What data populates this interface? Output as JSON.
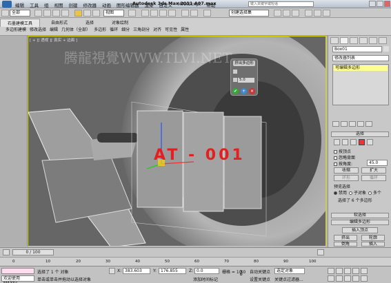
{
  "titlebar": {
    "menus": [
      "编辑",
      "工具",
      "组",
      "视图",
      "创建",
      "修改器",
      "动画",
      "图形编辑器",
      "渲染",
      "自定义",
      "MAXScript",
      "帮助"
    ],
    "title": "Autodesk 3ds Max  2011      A07.max",
    "search_placeholder": "键入关键字或短语"
  },
  "toolbar": {
    "selection_set": "全部",
    "view_mode": "视图",
    "named_set": "创建选择集"
  },
  "ribbon": {
    "tabs": [
      "石墨建模工具",
      "自由形式",
      "选择",
      "对象绘制"
    ],
    "items": [
      "多边形建模",
      "修改选择",
      "编辑",
      "几何体（全部）",
      "多边形",
      "循环",
      "细分",
      "三角剖分",
      "对齐",
      "可见性",
      "属性"
    ]
  },
  "viewport": {
    "label": "[ + ][ 透视 ][ 真实 + 边面 ]",
    "watermark": "腾龍視覺WWW.TLVI.NET",
    "object_text": "AT - 001"
  },
  "popup": {
    "title": "挤出多边形",
    "value": "5.0"
  },
  "panel": {
    "object_name": "Box01",
    "modifier_list": "修改器列表",
    "stack_item": "可编辑多边形",
    "rollout_selection": "选择",
    "by_vertex": "按顶点",
    "ignore_back": "忽略背面",
    "by_angle": "按角度:",
    "angle_value": "45.0",
    "shrink": "收缩",
    "grow": "扩大",
    "ring": "环形",
    "loop": "循环",
    "preview_label": "预览选择",
    "preview_off": "禁用",
    "preview_sub": "子对象",
    "preview_multi": "多个",
    "selected_info": "选择了 6 个多边形",
    "soft_selection": "软选择",
    "edit_polygons": "编辑多边形",
    "insert_vertex": "插入顶点",
    "extrude": "挤出",
    "outline": "轮廓",
    "bevel": "倒角",
    "inset": "插入",
    "bridge": "桥",
    "flip": "翻转"
  },
  "timeline": {
    "frame": "0 / 100",
    "ticks": [
      "0",
      "10",
      "20",
      "30",
      "40",
      "50",
      "60",
      "70",
      "80",
      "90",
      "100"
    ]
  },
  "status": {
    "selected": "选择了 1 个 对象",
    "prompt": "单击或单击并拖动以选择对象",
    "x_label": "X:",
    "x": "383.603",
    "y_label": "Y:",
    "y": "176.855",
    "z_label": "Z:",
    "z": "0.0",
    "grid": "栅格 = 10.0",
    "autokey": "自动关键点",
    "set_key": "设置关键点",
    "key_filter": "关键点过滤器...",
    "selected_obj": "选定对象",
    "add_time_tag": "添加时间标记",
    "welcome": "欢迎使用  MAXSc"
  }
}
